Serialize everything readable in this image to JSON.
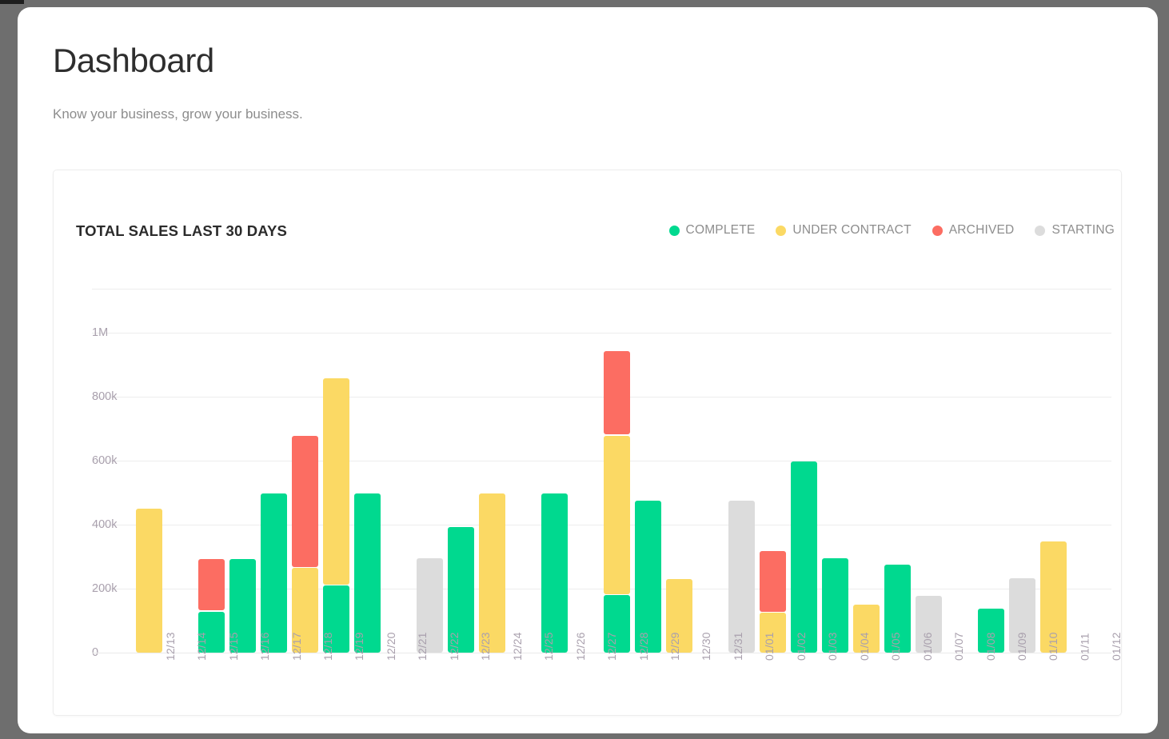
{
  "page": {
    "title": "Dashboard",
    "subtitle": "Know your business, grow your business."
  },
  "chart_card": {
    "title": "TOTAL SALES LAST 30 DAYS",
    "legend": [
      {
        "label": "COMPLETE",
        "color": "#00d98f",
        "icon": "legend-dot-icon"
      },
      {
        "label": "UNDER CONTRACT",
        "color": "#fbd964",
        "icon": "legend-dot-icon"
      },
      {
        "label": "ARCHIVED",
        "color": "#fc6d62",
        "icon": "legend-dot-icon"
      },
      {
        "label": "STARTING",
        "color": "#dcdcdc",
        "icon": "legend-dot-icon"
      }
    ]
  },
  "chart_data": {
    "type": "bar",
    "stacked": true,
    "title": "TOTAL SALES LAST 30 DAYS",
    "xlabel": "",
    "ylabel": "",
    "ylim": [
      0,
      1000000
    ],
    "yticks": [
      0,
      200000,
      400000,
      600000,
      800000,
      1000000
    ],
    "ytick_labels": [
      "0",
      "200k",
      "400k",
      "600k",
      "800k",
      "1M"
    ],
    "grid": true,
    "legend_position": "top-right",
    "categories": [
      "12/13",
      "12/14",
      "12/15",
      "12/16",
      "12/17",
      "12/18",
      "12/19",
      "12/20",
      "12/21",
      "12/22",
      "12/23",
      "12/24",
      "12/25",
      "12/26",
      "12/27",
      "12/28",
      "12/29",
      "12/30",
      "12/31",
      "01/01",
      "01/02",
      "01/03",
      "01/04",
      "01/05",
      "01/06",
      "01/07",
      "01/08",
      "01/09",
      "01/10",
      "01/11",
      "01/12"
    ],
    "series": [
      {
        "name": "COMPLETE",
        "color": "#00d98f",
        "values": [
          0,
          0,
          128000,
          293000,
          498000,
          0,
          210000,
          498000,
          0,
          0,
          393000,
          0,
          0,
          498000,
          0,
          180000,
          475000,
          0,
          0,
          0,
          0,
          598000,
          295000,
          0,
          275000,
          0,
          0,
          138000,
          0,
          0,
          0
        ]
      },
      {
        "name": "UNDER CONTRACT",
        "color": "#fbd964",
        "values": [
          450000,
          0,
          0,
          0,
          0,
          265000,
          645000,
          0,
          0,
          0,
          0,
          498000,
          0,
          0,
          0,
          495000,
          0,
          230000,
          0,
          0,
          125000,
          0,
          0,
          150000,
          0,
          0,
          0,
          0,
          0,
          348000,
          0
        ]
      },
      {
        "name": "ARCHIVED",
        "color": "#fc6d62",
        "values": [
          0,
          0,
          162000,
          0,
          0,
          410000,
          0,
          0,
          0,
          0,
          0,
          0,
          0,
          0,
          0,
          260000,
          0,
          0,
          0,
          0,
          190000,
          0,
          0,
          0,
          0,
          0,
          0,
          0,
          0,
          0,
          0
        ]
      },
      {
        "name": "STARTING",
        "color": "#dcdcdc",
        "values": [
          0,
          0,
          0,
          0,
          0,
          0,
          0,
          0,
          0,
          295000,
          0,
          0,
          0,
          0,
          0,
          0,
          0,
          0,
          0,
          475000,
          0,
          0,
          0,
          0,
          0,
          178000,
          0,
          0,
          233000,
          0,
          0
        ]
      }
    ],
    "totals": [
      450000,
      0,
      290000,
      293000,
      498000,
      675000,
      855000,
      498000,
      0,
      295000,
      393000,
      498000,
      0,
      498000,
      0,
      935000,
      475000,
      230000,
      0,
      475000,
      315000,
      598000,
      295000,
      150000,
      275000,
      178000,
      0,
      138000,
      233000,
      348000,
      0
    ]
  }
}
